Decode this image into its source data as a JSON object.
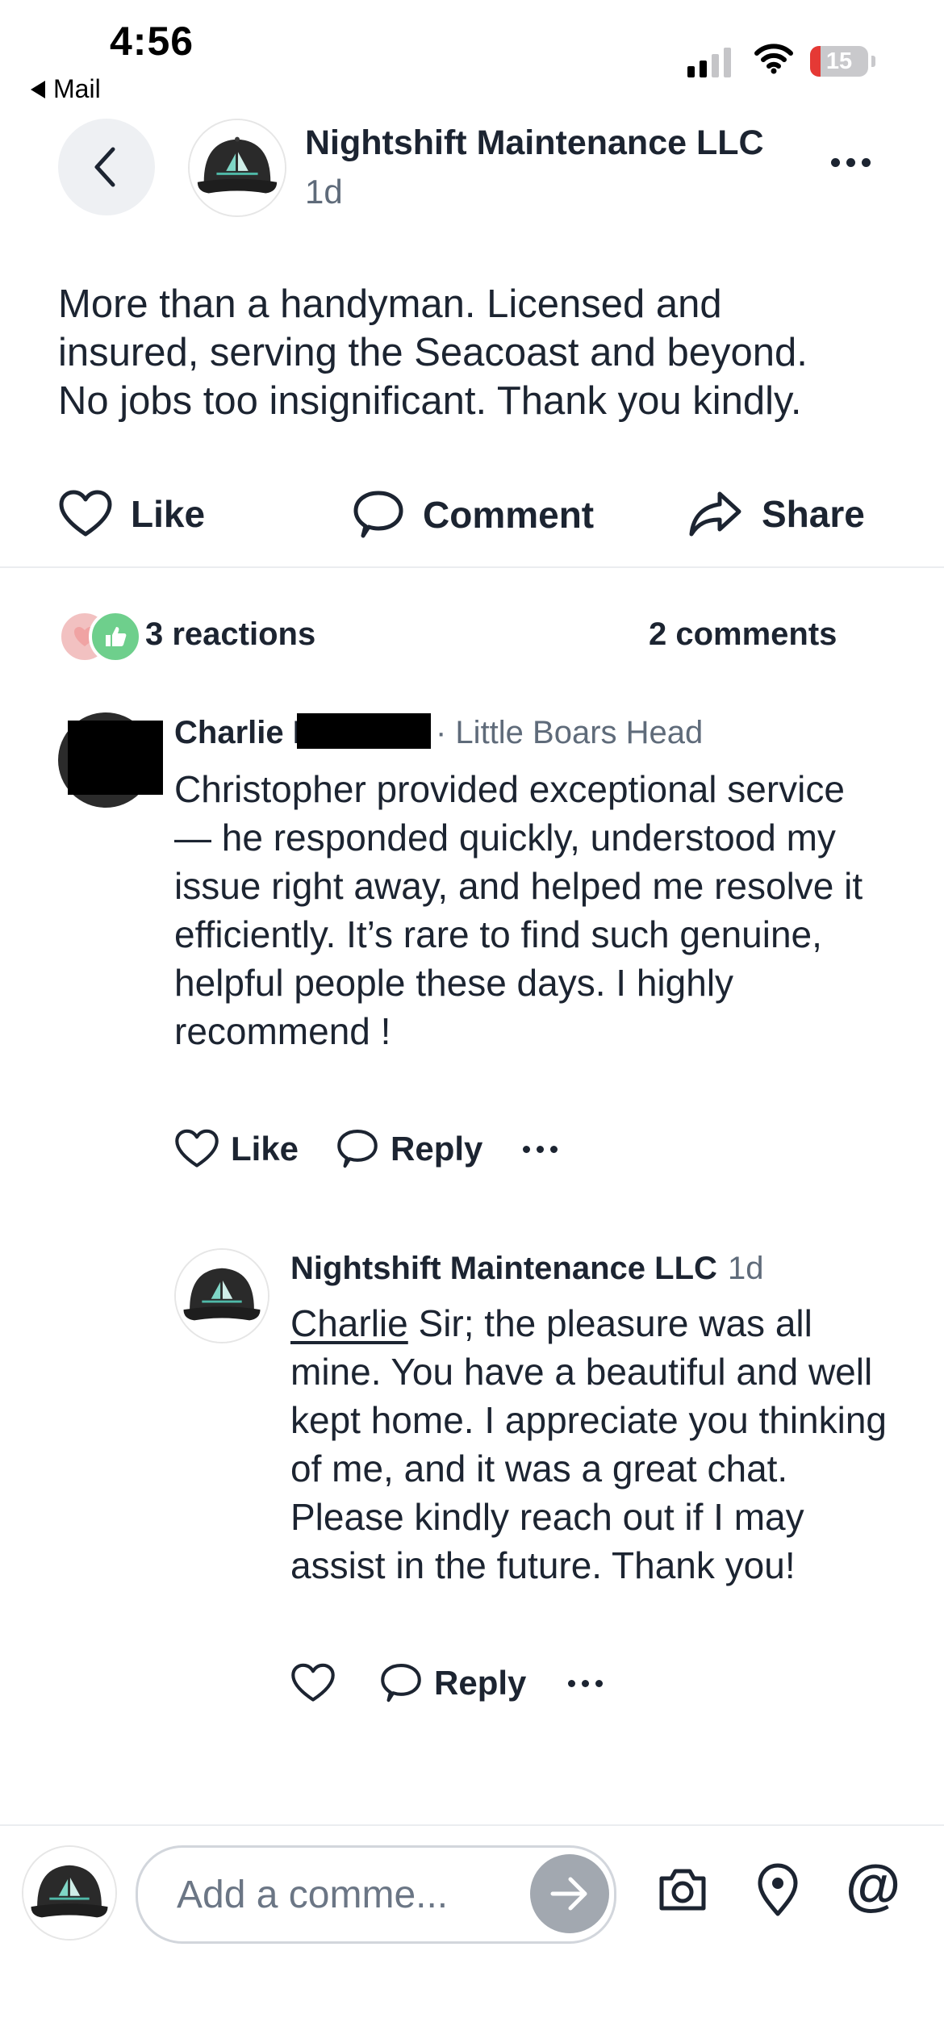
{
  "status_bar": {
    "time": "4:56",
    "back_app": "Mail",
    "battery_level": "15",
    "icons": [
      "cellular-signal-icon",
      "wifi-icon",
      "battery-icon"
    ]
  },
  "post": {
    "author": "Nightshift Maintenance LLC",
    "time": "1d",
    "body": "More than a handyman.  Licensed and\ninsured, serving the Seacoast and beyond.\nNo jobs too insignificant.  Thank you kindly.",
    "actions": {
      "like": "Like",
      "comment": "Comment",
      "share": "Share"
    },
    "reactions_count": "3 reactions",
    "comments_count": "2 comments"
  },
  "comment": {
    "author": "Charlie F",
    "location": "· Little Boars Head",
    "text": "Christopher provided exceptional service — he responded quickly, understood my issue right away, and helped me resolve it efficiently. It’s rare to find such genuine, helpful people these days. I highly recommend !",
    "like_label": "Like",
    "reply_label": "Reply"
  },
  "reply": {
    "author": "Nightshift Maintenance LLC",
    "time": "1d",
    "mention": "Charlie",
    "text": " Sir; the pleasure was all mine.  You have a beautiful and well kept home. I appreciate you thinking of me, and it was a great chat.  Please kindly reach out if I may assist in the future.  Thank you!",
    "reply_label": "Reply"
  },
  "composer": {
    "placeholder": "Add a comme...",
    "icons": [
      "send-arrow-icon",
      "camera-icon",
      "location-pin-icon",
      "at-sign-icon"
    ]
  },
  "colors": {
    "text": "#1c2431",
    "secondary": "#5f6b7a",
    "divider": "#ebedf0",
    "back_button_bg": "#eef0f3",
    "send_button_bg": "#a2a8b0",
    "heart_reaction": "#f2c1c1",
    "thumb_reaction": "#6ecf8c"
  }
}
